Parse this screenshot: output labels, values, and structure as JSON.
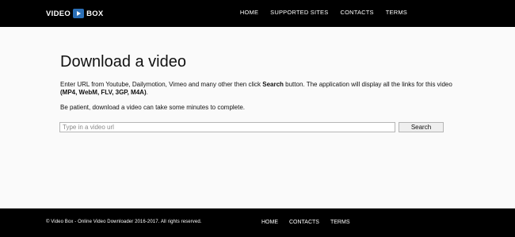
{
  "header": {
    "logo_left": "VIDEO",
    "logo_right": "BOX",
    "nav": [
      "HOME",
      "SUPPORTED SITES",
      "CONTACTS",
      "TERMS"
    ]
  },
  "main": {
    "title": "Download a video",
    "desc_intro": "Enter URL from Youtube, Dailymotion, Vimeo and many other then click ",
    "desc_search_bold": "Search",
    "desc_mid": " button. The application will display all the links for this video ",
    "desc_formats_bold": "(MP4, WebM, FLV, 3GP, M4A)",
    "desc_end": ".",
    "note": "Be patient, download a video can take some minutes to complete.",
    "search_placeholder": "Type in a video url",
    "search_value": "",
    "search_button": "Search"
  },
  "footer": {
    "copyright": "© Video Box - Online Video Downloader  2016-2017.    All rights reserved.",
    "nav": [
      "HOME",
      "CONTACTS",
      "TERMS"
    ]
  },
  "colors": {
    "bar": "#000000",
    "logo_badge": "#2b6fb6",
    "background": "#fafafa"
  }
}
